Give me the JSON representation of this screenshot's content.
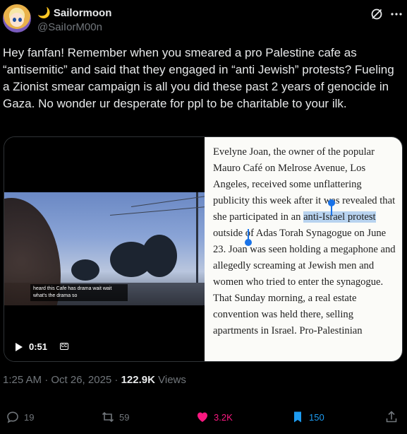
{
  "author": {
    "display_name": "🌙 Sailormoon",
    "handle": "@SaiIorM00n"
  },
  "tweet": {
    "text": "Hey fanfan! Remember when you smeared a pro Palestine cafe as “antisemitic” and said that they engaged in “anti Jewish” protests? Fueling a Zionist smear campaign is all you did these past 2 years of genocide in Gaza. No wonder ur desperate for ppl to be charitable to your ilk."
  },
  "video": {
    "caption": "heard this Cafe has drama wait wait what's the drama so",
    "time": "0:51",
    "cc_label": "CC"
  },
  "article": {
    "before": "Evelyne Joan, the owner of the popular Mauro Café on Melrose Avenue, Los Angeles, received some unflattering publicity this week after it was revealed that she participated in an ",
    "highlight": "anti-Israel protest",
    "after": " outside of Adas Torah Synagogue on June 23. Joan was seen holding a megaphone and allegedly screaming at Jewish men and women who tried to enter the synagogue. That Sunday morning, a real estate convention was held there, selling apartments in Israel. Pro-Palestinian"
  },
  "meta": {
    "timestamp": "1:25 AM · Oct 26, 2025 · ",
    "views_count": "122.9K",
    "views_label": " Views"
  },
  "actions": {
    "replies": "19",
    "reposts": "59",
    "likes": "3.2K",
    "bookmarks": "150"
  },
  "colors": {
    "background": "#000000",
    "text": "#e7e9ea",
    "muted": "#71767b",
    "like": "#f91880",
    "bookmark": "#1d9bf0",
    "highlight": "#b8d3ef",
    "selection_handle": "#1a73e8"
  },
  "icons": [
    "grok-icon",
    "more-icon",
    "play-icon",
    "cc-icon",
    "reply-icon",
    "retweet-icon",
    "heart-icon",
    "bookmark-icon",
    "share-icon"
  ]
}
